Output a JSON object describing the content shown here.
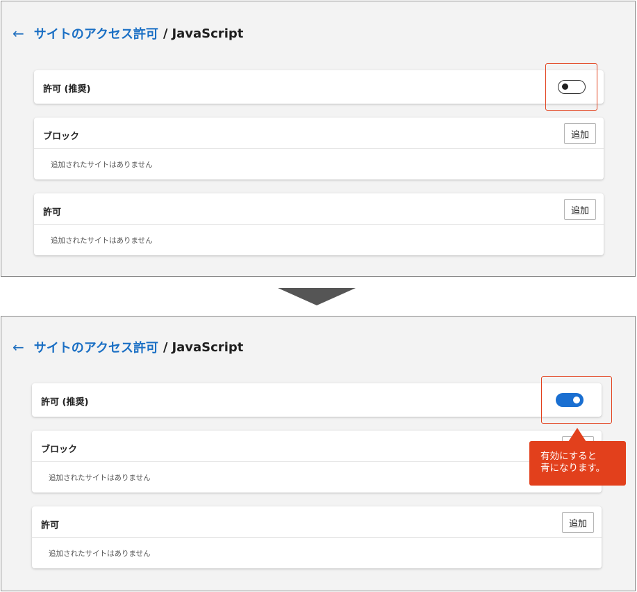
{
  "header": {
    "back_icon": "←",
    "crumb_link": "サイトのアクセス許可",
    "separator": "/",
    "current": "JavaScript"
  },
  "settings": {
    "allow_recommended_label": "許可 (推奨)",
    "block_label": "ブロック",
    "allow_label": "許可",
    "add_button_label": "追加",
    "empty_text": "追加されたサイトはありません"
  },
  "state_before": {
    "javascript_allowed": false
  },
  "state_after": {
    "javascript_allowed": true
  },
  "callout": {
    "line1": "有効にすると",
    "line2": "青になります。"
  },
  "colors": {
    "accent": "#1a6fd1",
    "link": "#1a6fc4",
    "highlight": "#e2401c",
    "arrow": "#555555"
  },
  "icons": {
    "back": "back-arrow-icon",
    "transition": "down-triangle-icon"
  }
}
